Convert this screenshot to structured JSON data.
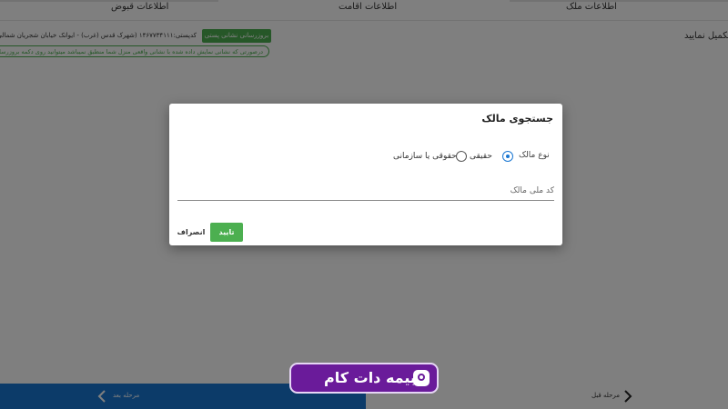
{
  "tabs": {
    "owner": "اطلاعات ملک",
    "residence": "اطلاعات اقامت",
    "bills": "اطلاعات قبوض"
  },
  "form": {
    "complete_label": "تکمیل نمایید",
    "postal_button": "بروزرسانی نشانی پستی",
    "address": "کدپستی:۱۴۶۷۷۳۴۱۱۱ (شهرک قدس (غرب) - ایوانک خیابان شجریان شمالی (فلامک",
    "notice": "درصورتی که نشانی نمایش داده شده با نشانی واقعی منزل شما منطبق نمیباشد میتوانید روی دکمه بروزرسانی نشا"
  },
  "modal": {
    "title": "جستجوی مالک",
    "owner_type_label": "نوع مالک",
    "options": {
      "real": "حقیقی",
      "legal": "حقوقی یا سازمانی"
    },
    "selected": "real",
    "nid_placeholder": "کد ملی مالک",
    "ok_label": "تایید",
    "cancel_label": "انصراف"
  },
  "footer": {
    "next_label": "مرحله بعد",
    "prev_label": "مرحله قبل"
  },
  "watermark": {
    "text": "بیمه دات کام"
  },
  "colors": {
    "primary_blue": "#1976d2",
    "green": "#4caf50",
    "watermark_purple": "#6a1b9a"
  },
  "icons": {
    "next": "chevron-left-icon",
    "prev": "chevron-right-icon"
  }
}
